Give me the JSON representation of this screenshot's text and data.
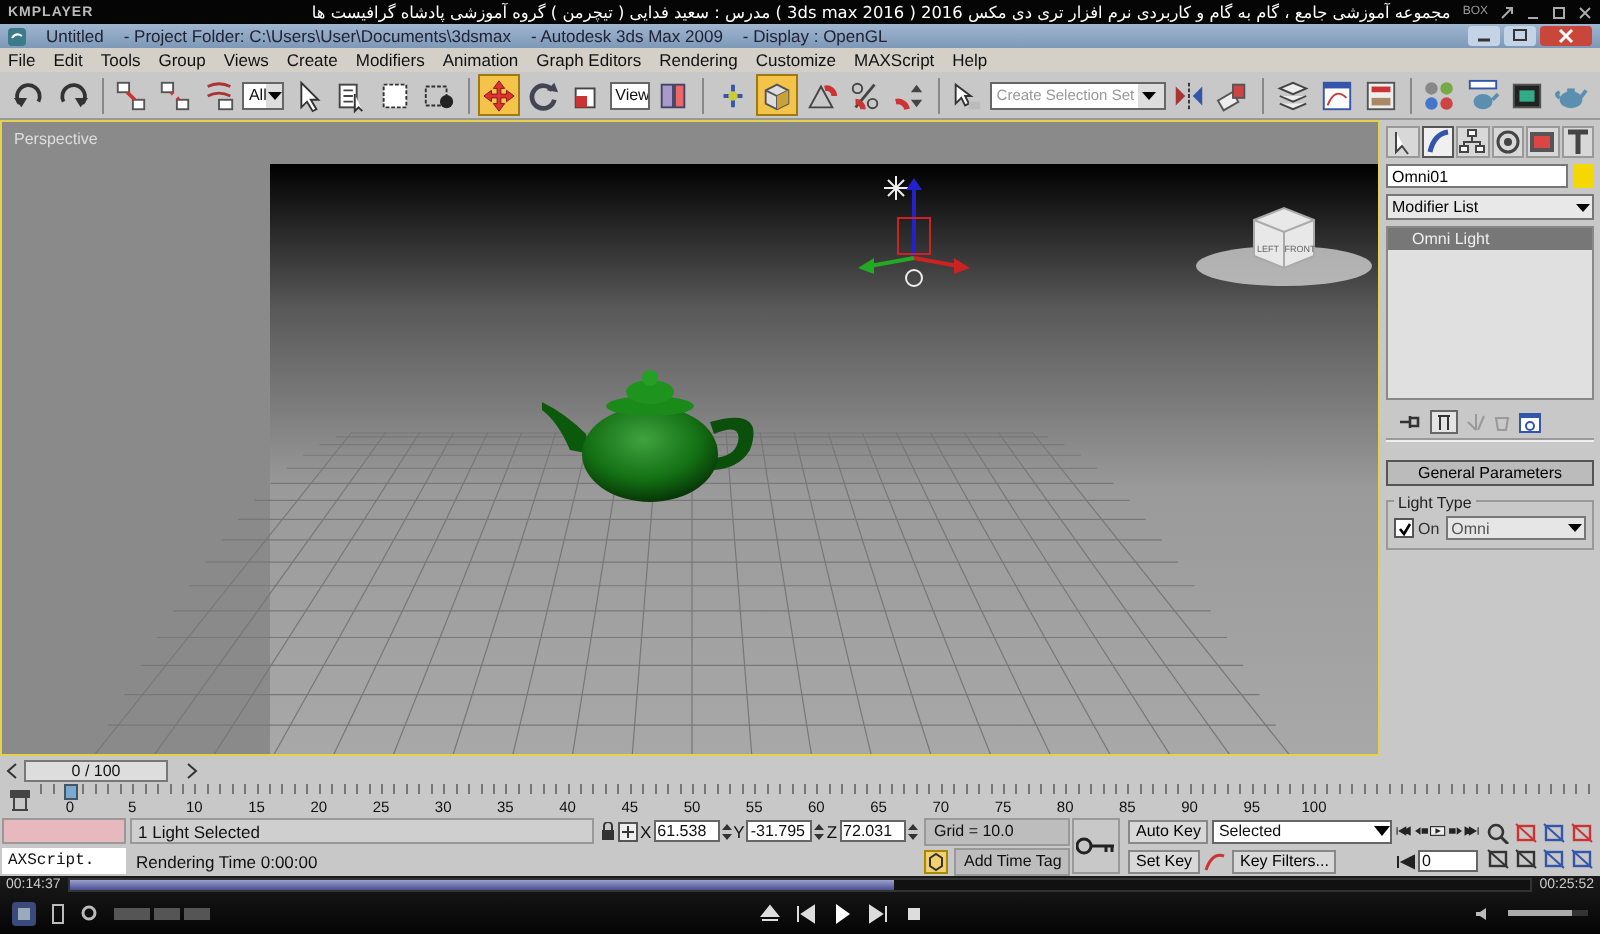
{
  "player": {
    "logo": "KMPLAYER",
    "title": "مجموعه آموزشی جامع ، گام به گام و کاربردی نرم افزار تری دی مکس 2016 ( 3ds max 2016 )  مدرس : سعید فدایی ( تیچرمن ) گروه آموزشی پادشاه گرافیست ها",
    "badge": "BOX",
    "elapsed": "00:14:37",
    "total": "00:25:52",
    "seek": {
      "level": 0.565
    },
    "volume": {
      "level": 0.8
    }
  },
  "window": {
    "document": "Untitled",
    "project": "- Project Folder: C:\\Users\\User\\Documents\\3dsmax",
    "app": "- Autodesk 3ds Max  2009",
    "display": "- Display : OpenGL"
  },
  "menu": [
    "File",
    "Edit",
    "Tools",
    "Group",
    "Views",
    "Create",
    "Modifiers",
    "Animation",
    "Graph Editors",
    "Rendering",
    "Customize",
    "MAXScript",
    "Help"
  ],
  "toolbar": [
    {
      "kind": "undo",
      "selected": false
    },
    {
      "kind": "redo",
      "selected": false
    },
    {
      "kind": "separator"
    },
    {
      "kind": "link",
      "selected": false
    },
    {
      "kind": "unlink",
      "selected": false
    },
    {
      "kind": "bind",
      "selected": false
    },
    {
      "kind": "dropdown",
      "value": "All"
    },
    {
      "kind": "select",
      "selected": false
    },
    {
      "kind": "select-by-name",
      "selected": false
    },
    {
      "kind": "region",
      "selected": false
    },
    {
      "kind": "crossing",
      "selected": false
    },
    {
      "kind": "separator"
    },
    {
      "kind": "move",
      "selected": true
    },
    {
      "kind": "rotate",
      "selected": false
    },
    {
      "kind": "scale",
      "selected": false
    },
    {
      "kind": "dropdown",
      "value": "View"
    },
    {
      "kind": "pivot",
      "selected": false
    },
    {
      "kind": "separator"
    },
    {
      "kind": "manipulate",
      "selected": false
    },
    {
      "kind": "snap",
      "selected": true
    },
    {
      "kind": "angle-snap",
      "selected": false
    },
    {
      "kind": "percent-snap",
      "selected": false
    },
    {
      "kind": "spinner-snap",
      "selected": false
    },
    {
      "kind": "separator"
    },
    {
      "kind": "named-selection",
      "selected": false
    },
    {
      "kind": "combo",
      "placeholder": "Create Selection Set"
    },
    {
      "kind": "mirror",
      "selected": false
    },
    {
      "kind": "align",
      "selected": false
    },
    {
      "kind": "separator"
    },
    {
      "kind": "layers",
      "selected": false
    },
    {
      "kind": "curve-editor",
      "selected": false
    },
    {
      "kind": "schematic",
      "selected": false
    },
    {
      "kind": "separator"
    },
    {
      "kind": "material",
      "selected": false
    },
    {
      "kind": "render-setup",
      "selected": false
    },
    {
      "kind": "rendered-frame",
      "selected": false
    },
    {
      "kind": "render",
      "selected": false
    }
  ],
  "viewport": {
    "label": "Perspective",
    "viewcube": [
      "LEFT",
      "FRONT"
    ]
  },
  "command_panel": {
    "tabs": [
      {
        "kind": "create",
        "selected": false
      },
      {
        "kind": "modify",
        "selected": true
      },
      {
        "kind": "hierarchy",
        "selected": false
      },
      {
        "kind": "motion",
        "selected": false
      },
      {
        "kind": "display",
        "selected": false
      },
      {
        "kind": "utilities",
        "selected": false
      }
    ],
    "object_name": "Omni01",
    "modifier_list": "Modifier List",
    "stack": [
      {
        "label": "Omni Light",
        "selected": true
      }
    ],
    "rollout": "General Parameters",
    "group": "Light Type",
    "on": {
      "label": "On",
      "checked": true
    },
    "light_type": "Omni"
  },
  "time_slider": {
    "label": "0 / 100",
    "level": 0
  },
  "track_labels": [
    "0",
    "5",
    "10",
    "15",
    "20",
    "25",
    "30",
    "35",
    "40",
    "45",
    "50",
    "55",
    "60",
    "65",
    "70",
    "75",
    "80",
    "85",
    "90",
    "95",
    "100"
  ],
  "status": {
    "listener": "AXScript.",
    "prompt": "1 Light Selected",
    "rendering": "Rendering Time  0:00:00",
    "coords": [
      {
        "axis": "X",
        "value": "61.538"
      },
      {
        "axis": "Y",
        "value": "-31.795"
      },
      {
        "axis": "Z",
        "value": "72.031"
      }
    ],
    "grid": "Grid = 10.0",
    "time_tag": "Add Time Tag",
    "auto_key": "Auto Key",
    "key_mode": "Selected",
    "set_key": "Set Key",
    "key_filters": "Key Filters...",
    "frame": "0"
  }
}
